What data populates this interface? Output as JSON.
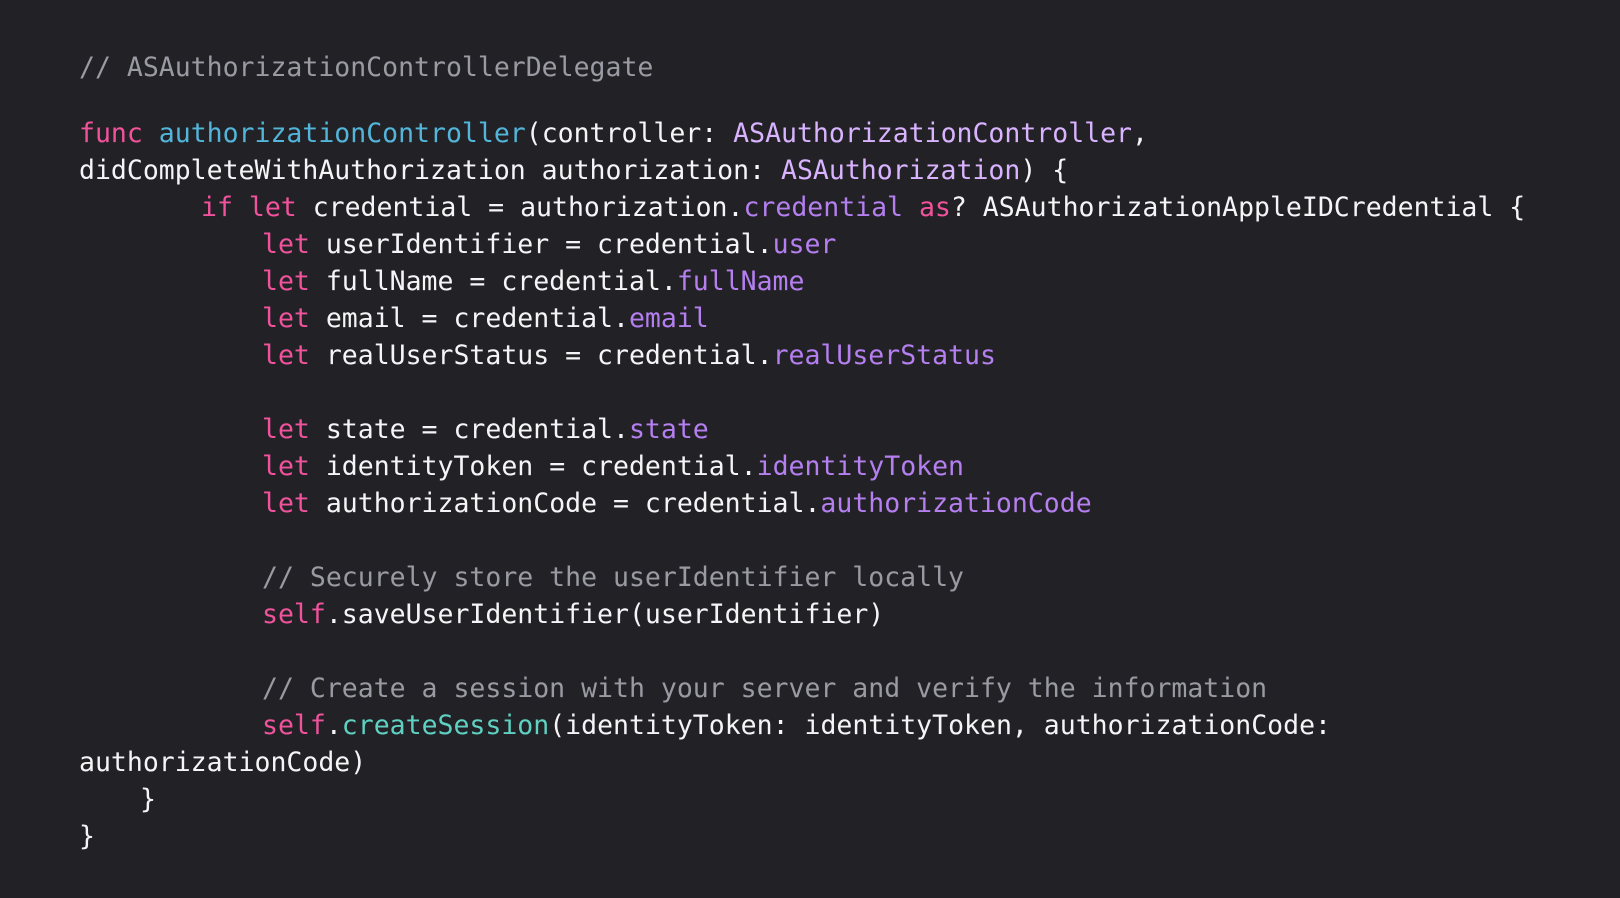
{
  "editor": {
    "background": "#222226",
    "colors": {
      "plain": "#f5f5f7",
      "keyword": "#f0529c",
      "comment": "#9a9aa3",
      "function_declaration": "#52b5d9",
      "type": "#c98cff",
      "property": "#b57ff0",
      "method": "#5fd1c3"
    },
    "lines": [
      {
        "tokens": [
          {
            "t": "comment",
            "v": "// ASAuthorizationControllerDelegate"
          }
        ]
      },
      {
        "tokens": [
          {
            "t": "keyword",
            "v": "func "
          },
          {
            "t": "funcdecl",
            "v": "authorizationController"
          },
          {
            "t": "plain",
            "v": "(controller: "
          },
          {
            "t": "type",
            "v": "ASAuthorizationController"
          },
          {
            "t": "plain",
            "v": ","
          }
        ]
      },
      {
        "tokens": [
          {
            "t": "plain",
            "v": "didCompleteWithAuthorization authorization: "
          },
          {
            "t": "type",
            "v": "ASAuthorization"
          },
          {
            "t": "plain",
            "v": ") {"
          }
        ]
      },
      {
        "tokens": [
          {
            "t": "keyword",
            "v": "if let "
          },
          {
            "t": "plain",
            "v": "credential = authorization."
          },
          {
            "t": "prop",
            "v": "credential "
          },
          {
            "t": "keyword",
            "v": "as"
          },
          {
            "t": "plain",
            "v": "? ASAuthorizationAppleIDCredential {"
          }
        ]
      },
      {
        "tokens": [
          {
            "t": "keyword",
            "v": "let "
          },
          {
            "t": "plain",
            "v": "userIdentifier = credential."
          },
          {
            "t": "prop",
            "v": "user"
          }
        ]
      },
      {
        "tokens": [
          {
            "t": "keyword",
            "v": "let "
          },
          {
            "t": "plain",
            "v": "fullName = credential."
          },
          {
            "t": "prop",
            "v": "fullName"
          }
        ]
      },
      {
        "tokens": [
          {
            "t": "keyword",
            "v": "let "
          },
          {
            "t": "plain",
            "v": "email = credential."
          },
          {
            "t": "prop",
            "v": "email"
          }
        ]
      },
      {
        "tokens": [
          {
            "t": "keyword",
            "v": "let "
          },
          {
            "t": "plain",
            "v": "realUserStatus = credential."
          },
          {
            "t": "prop",
            "v": "realUserStatus"
          }
        ]
      },
      {
        "tokens": [
          {
            "t": "keyword",
            "v": "let "
          },
          {
            "t": "plain",
            "v": "state = credential."
          },
          {
            "t": "prop",
            "v": "state"
          }
        ]
      },
      {
        "tokens": [
          {
            "t": "keyword",
            "v": "let "
          },
          {
            "t": "plain",
            "v": "identityToken = credential."
          },
          {
            "t": "prop",
            "v": "identityToken"
          }
        ]
      },
      {
        "tokens": [
          {
            "t": "keyword",
            "v": "let "
          },
          {
            "t": "plain",
            "v": "authorizationCode = credential."
          },
          {
            "t": "prop",
            "v": "authorizationCode"
          }
        ]
      },
      {
        "tokens": [
          {
            "t": "comment",
            "v": "// Securely store the userIdentifier locally"
          }
        ]
      },
      {
        "tokens": [
          {
            "t": "keyword",
            "v": "self"
          },
          {
            "t": "plain",
            "v": ".saveUserIdentifier(userIdentifier)"
          }
        ]
      },
      {
        "tokens": [
          {
            "t": "comment",
            "v": "// Create a session with your server and verify the information"
          }
        ]
      },
      {
        "tokens": [
          {
            "t": "keyword",
            "v": "self"
          },
          {
            "t": "plain",
            "v": "."
          },
          {
            "t": "method",
            "v": "createSession"
          },
          {
            "t": "plain",
            "v": "(identityToken: identityToken, authorizationCode:"
          }
        ]
      },
      {
        "tokens": [
          {
            "t": "plain",
            "v": "authorizationCode)"
          }
        ]
      },
      {
        "tokens": [
          {
            "t": "plain",
            "v": "}"
          }
        ]
      },
      {
        "tokens": [
          {
            "t": "plain",
            "v": "}"
          }
        ]
      }
    ]
  }
}
